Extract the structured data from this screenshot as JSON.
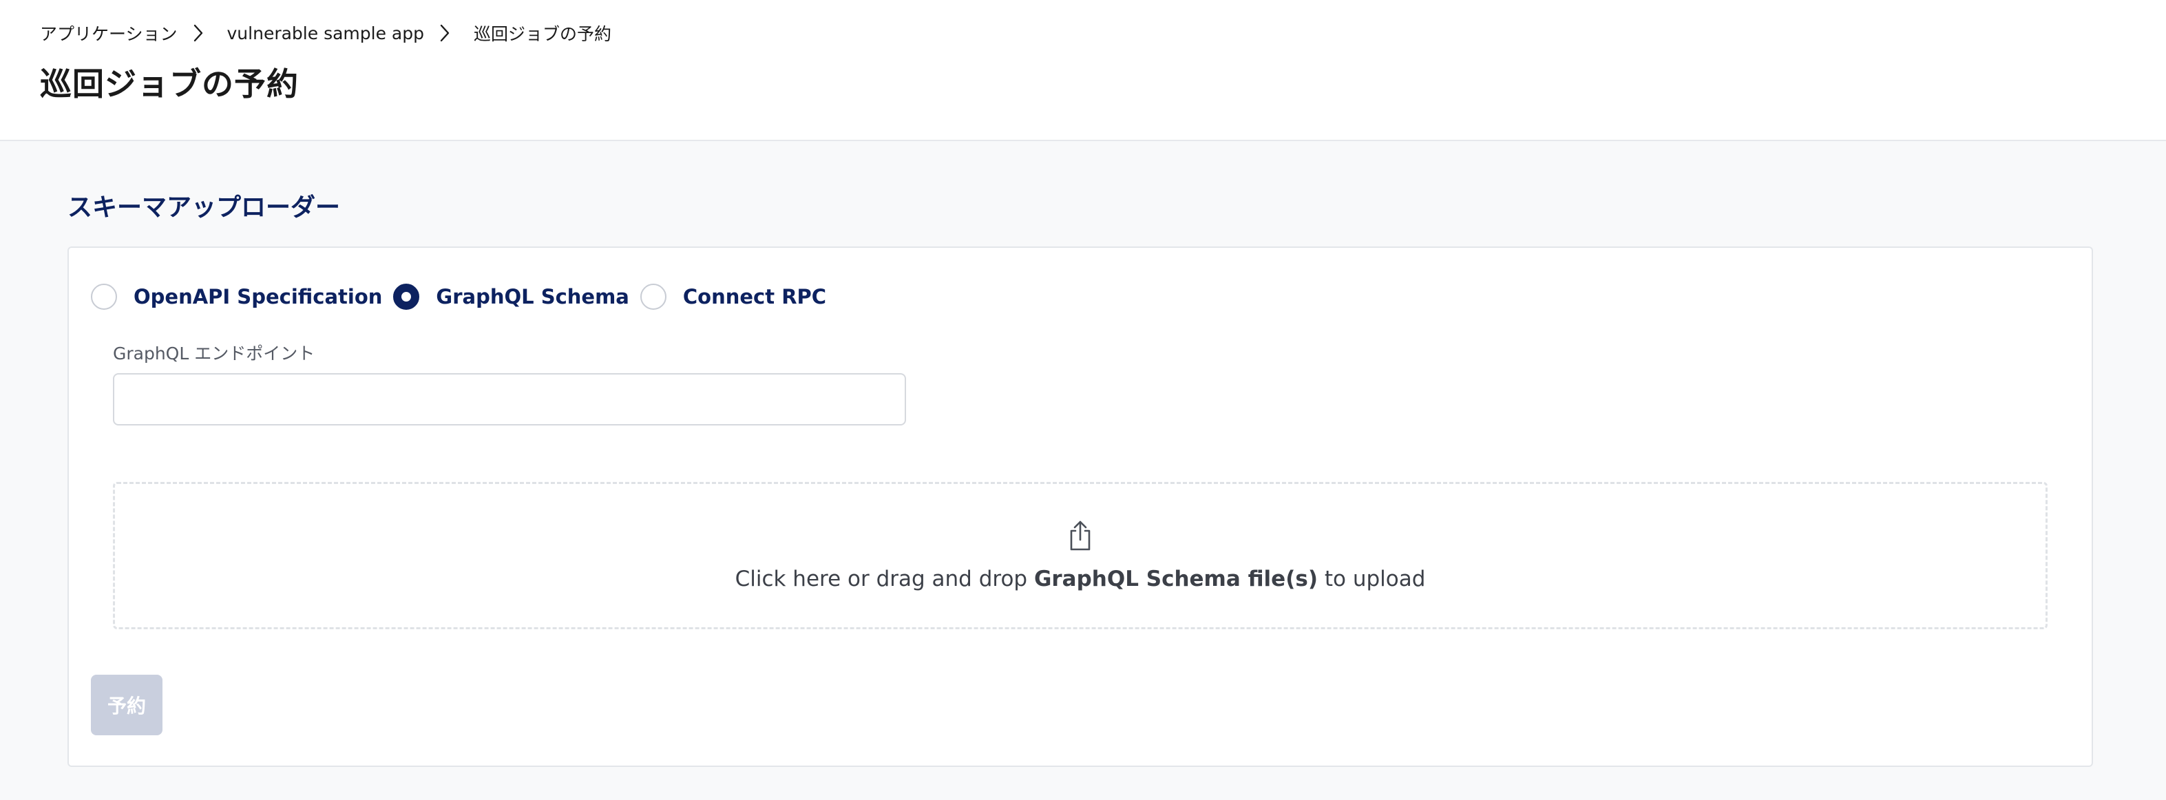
{
  "breadcrumb": {
    "items": [
      "アプリケーション",
      "vulnerable sample app",
      "巡回ジョブの予約"
    ]
  },
  "page_title": "巡回ジョブの予約",
  "section_title": "スキーマアップローダー",
  "schema_types": {
    "options": [
      {
        "label": "OpenAPI Specification",
        "checked": false
      },
      {
        "label": "GraphQL Schema",
        "checked": true
      },
      {
        "label": "Connect RPC",
        "checked": false
      }
    ]
  },
  "endpoint_field": {
    "label": "GraphQL エンドポイント",
    "value": "",
    "placeholder": ""
  },
  "upload": {
    "icon": "upload-icon",
    "text_before": "Click here or drag and drop ",
    "text_bold": "GraphQL Schema file(s)",
    "text_after": " to upload"
  },
  "submit_button": {
    "label": "予約",
    "disabled": true
  },
  "colors": {
    "accent": "#0d2260",
    "page_background": "#f8f9fa",
    "disabled_button": "#c9cfde"
  }
}
